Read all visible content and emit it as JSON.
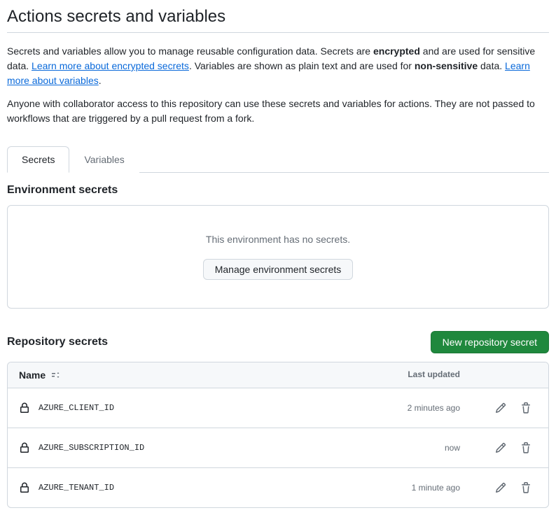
{
  "page": {
    "title": "Actions secrets and variables"
  },
  "intro": {
    "p1_a": "Secrets and variables allow you to manage reusable configuration data. Secrets are ",
    "p1_b_bold": "encrypted",
    "p1_c": " and are used for sensitive data. ",
    "p1_link1": "Learn more about encrypted secrets",
    "p1_d": ". Variables are shown as plain text and are used for ",
    "p1_e_bold": "non-sensitive",
    "p1_f": " data. ",
    "p1_link2": "Learn more about variables",
    "p1_g": ".",
    "p2": "Anyone with collaborator access to this repository can use these secrets and variables for actions. They are not passed to workflows that are triggered by a pull request from a fork."
  },
  "tabs": {
    "secrets": "Secrets",
    "variables": "Variables"
  },
  "env": {
    "title": "Environment secrets",
    "empty": "This environment has no secrets.",
    "manage_btn": "Manage environment secrets"
  },
  "repo": {
    "title": "Repository secrets",
    "new_btn": "New repository secret",
    "col_name": "Name",
    "col_updated": "Last updated",
    "rows": [
      {
        "name": "AZURE_CLIENT_ID",
        "updated": "2 minutes ago"
      },
      {
        "name": "AZURE_SUBSCRIPTION_ID",
        "updated": "now"
      },
      {
        "name": "AZURE_TENANT_ID",
        "updated": "1 minute ago"
      }
    ]
  }
}
